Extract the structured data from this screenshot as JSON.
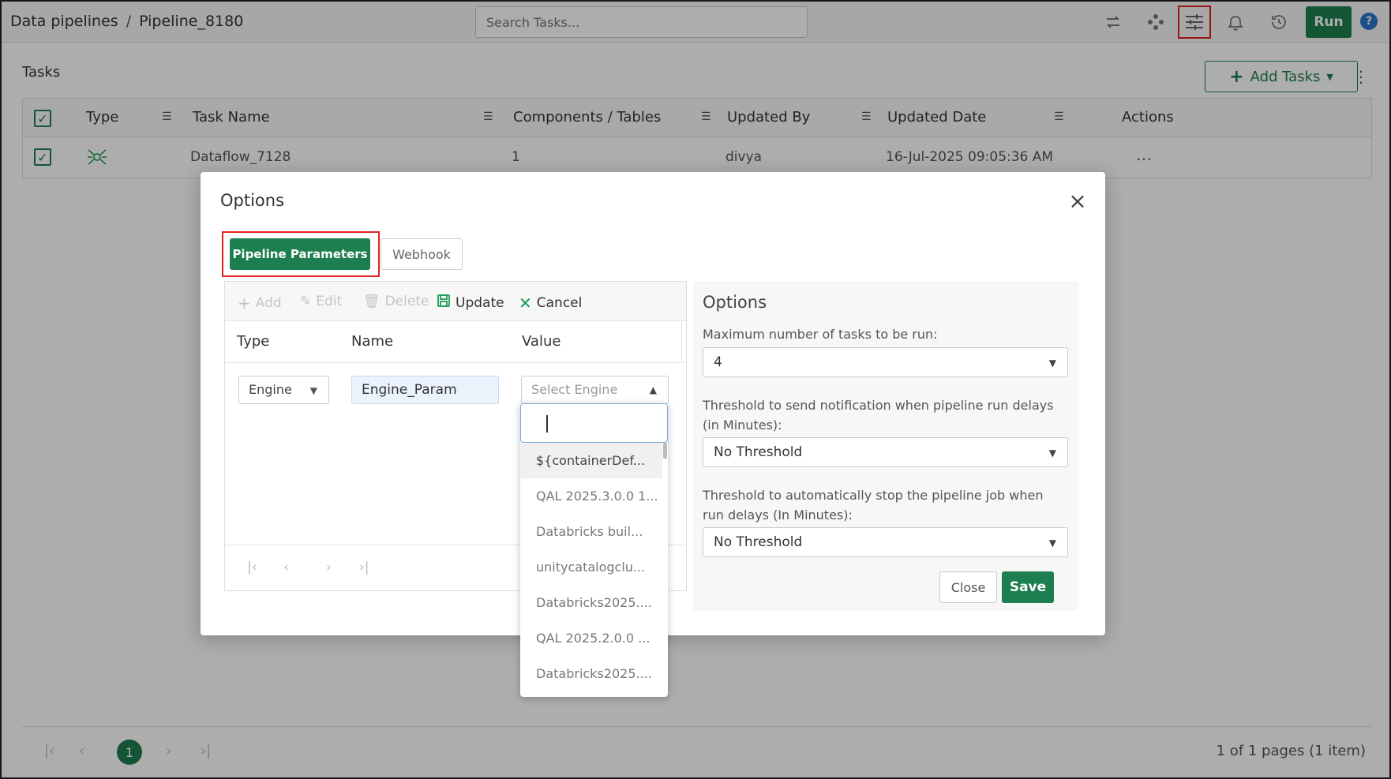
{
  "breadcrumb": {
    "root": "Data pipelines",
    "separator": "/",
    "current": "Pipeline_8180"
  },
  "search": {
    "placeholder": "Search Tasks..."
  },
  "toolbar": {
    "run_label": "Run",
    "help_label": "?"
  },
  "tasks": {
    "title": "Tasks",
    "add_label": "Add Tasks",
    "columns": [
      "Type",
      "Task Name",
      "Components / Tables",
      "Updated By",
      "Updated Date",
      "Actions"
    ],
    "rows": [
      {
        "task_name": "Dataflow_7128",
        "components": "1",
        "updated_by": "divya",
        "updated_date": "16-Jul-2025 09:05:36 AM",
        "actions": "…"
      }
    ],
    "pager": {
      "current_page": "1",
      "info": "1 of 1 pages (1 item)"
    }
  },
  "modal": {
    "title": "Options",
    "tabs": {
      "pipeline_parameters": "Pipeline Parameters",
      "webhook": "Webhook"
    },
    "param_toolbar": {
      "add": "Add",
      "edit": "Edit",
      "delete": "Delete",
      "update": "Update",
      "cancel": "Cancel"
    },
    "param_columns": {
      "type": "Type",
      "name": "Name",
      "value": "Value"
    },
    "param_row": {
      "type": "Engine",
      "name": "Engine_Param",
      "value_placeholder": "Select Engine"
    },
    "engine_options": [
      "${containerDef...",
      "QAL 2025.3.0.0 1...",
      "Databricks buil...",
      "unitycatalogclu...",
      "Databricks2025....",
      "QAL 2025.2.0.0 ...",
      "Databricks2025...."
    ],
    "options_panel": {
      "title": "Options",
      "max_tasks_label": "Maximum number of tasks to be run:",
      "max_tasks_value": "4",
      "notify_label": "Threshold to send notification when pipeline run delays (in Minutes):",
      "notify_value": "No Threshold",
      "stop_label": "Threshold to automatically stop the pipeline job when run delays (In Minutes):",
      "stop_value": "No Threshold",
      "close_label": "Close",
      "save_label": "Save"
    }
  },
  "colors": {
    "accent": "#1d7e4f",
    "highlight": "#e02020",
    "help": "#2a74c9"
  }
}
